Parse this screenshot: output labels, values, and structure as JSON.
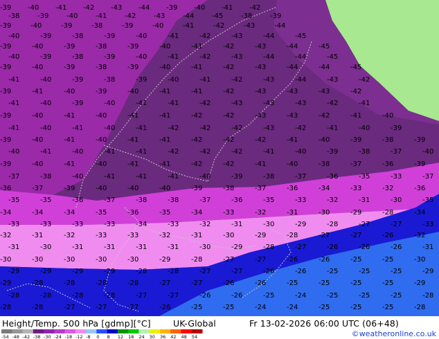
{
  "caption": {
    "left": "Height/Temp. 500 hPa [gdmp][°C]",
    "mid": "UK-Global",
    "right": "Fr 13-02-2026 06:00 UTC (06+48)"
  },
  "credit": "©weatheronline.co.uk",
  "scale": {
    "labels": [
      "-54",
      "-48",
      "-42",
      "-38",
      "-30",
      "-24",
      "-18",
      "-12",
      "-8",
      "0",
      "8",
      "12",
      "18",
      "24",
      "30",
      "36",
      "42",
      "48",
      "54"
    ],
    "colors": [
      "#7a7a7a",
      "#969696",
      "#b4b4b4",
      "#6e1a8c",
      "#8c28a8",
      "#b43cc8",
      "#dc5ae6",
      "#f08cf0",
      "#96c8f0",
      "#2850ff",
      "#0000c8",
      "#009600",
      "#00c800",
      "#b4f0b4",
      "#f0f000",
      "#ffb400",
      "#ff6400",
      "#ff0000",
      "#b40000"
    ]
  },
  "map": {
    "land_color": "#a8e890",
    "zones": [
      {
        "name": "-45 to -48",
        "color": "#6a2a7e"
      },
      {
        "name": "-40 to -44",
        "color": "#7c2f90"
      },
      {
        "name": "-36 to -40",
        "color": "#9a2aa8"
      },
      {
        "name": "-33 to -36",
        "color": "#d040d8"
      },
      {
        "name": "-30 to -33",
        "color": "#f08cf0"
      },
      {
        "name": "-27 to -30",
        "color": "#1a1ad4"
      },
      {
        "name": "-24 to -27",
        "color": "#2f6cf0"
      }
    ],
    "contour_labels": [
      "47",
      "46",
      "45",
      "44",
      "43",
      "42",
      "41",
      "40",
      "39",
      "38",
      "37",
      "36",
      "35",
      "34",
      "33",
      "32",
      "31",
      "30",
      "29",
      "28",
      "27",
      "26",
      "25",
      "24"
    ]
  }
}
